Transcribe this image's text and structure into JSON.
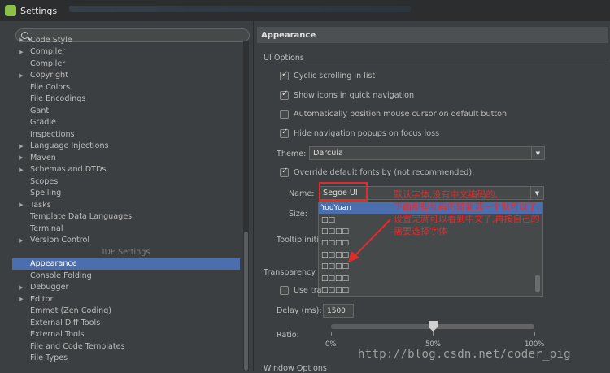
{
  "window": {
    "title": "Settings"
  },
  "search": {
    "placeholder": ""
  },
  "tree": {
    "items": [
      {
        "label": "Code Style",
        "arrow": "▶"
      },
      {
        "label": "Compiler",
        "arrow": "▶"
      },
      {
        "label": "Compiler",
        "arrow": ""
      },
      {
        "label": "Copyright",
        "arrow": "▶"
      },
      {
        "label": "File Colors",
        "arrow": ""
      },
      {
        "label": "File Encodings",
        "arrow": ""
      },
      {
        "label": "Gant",
        "arrow": ""
      },
      {
        "label": "Gradle",
        "arrow": ""
      },
      {
        "label": "Inspections",
        "arrow": ""
      },
      {
        "label": "Language Injections",
        "arrow": "▶"
      },
      {
        "label": "Maven",
        "arrow": "▶"
      },
      {
        "label": "Schemas and DTDs",
        "arrow": "▶"
      },
      {
        "label": "Scopes",
        "arrow": ""
      },
      {
        "label": "Spelling",
        "arrow": ""
      },
      {
        "label": "Tasks",
        "arrow": "▶"
      },
      {
        "label": "Template Data Languages",
        "arrow": ""
      },
      {
        "label": "Terminal",
        "arrow": ""
      },
      {
        "label": "Version Control",
        "arrow": "▶"
      }
    ],
    "group_label": "IDE Settings",
    "ide_items": [
      {
        "label": "Appearance",
        "arrow": ""
      },
      {
        "label": "Console Folding",
        "arrow": ""
      },
      {
        "label": "Debugger",
        "arrow": "▶"
      },
      {
        "label": "Editor",
        "arrow": "▶"
      },
      {
        "label": "Emmet (Zen Coding)",
        "arrow": ""
      },
      {
        "label": "External Diff Tools",
        "arrow": ""
      },
      {
        "label": "External Tools",
        "arrow": ""
      },
      {
        "label": "File and Code Templates",
        "arrow": ""
      },
      {
        "label": "File Types",
        "arrow": ""
      }
    ]
  },
  "panel": {
    "header": "Appearance",
    "ui_options_label": "UI Options",
    "checkboxes": [
      {
        "label": "Cyclic scrolling in list",
        "checked": true
      },
      {
        "label": "Show icons in quick navigation",
        "checked": true
      },
      {
        "label": "Automatically position mouse cursor on default button",
        "checked": false
      },
      {
        "label": "Hide navigation popups on focus loss",
        "checked": true
      }
    ],
    "theme_label": "Theme:",
    "theme_value": "Darcula",
    "override_label": "Override default fonts by (not recommended):",
    "override_checked": true,
    "name_label": "Name:",
    "name_value": "Segoe UI",
    "size_label": "Size:",
    "tooltip_label": "Tooltip initia",
    "font_options": [
      "YouYuan",
      "□□",
      "□□□□",
      "□□□□",
      "□□□□",
      "□□□□",
      "□□□□",
      "□□□□"
    ],
    "transparency_label": "Transparency",
    "use_transparency_label": "Use tra",
    "delay_label": "Delay (ms):",
    "delay_value": "1500",
    "ratio_label": "Ratio:",
    "ratio_value": 0.5,
    "ratio_ticks": [
      "0%",
      "50%",
      "100%"
    ],
    "window_options_label": "Window Options"
  },
  "annotation": {
    "line1": "默认字体,没有中文编码的,",
    "line2": "下面那些乱码的随便选一个就可以了,",
    "line3": "设置完就可以看到中文了,再按自己的",
    "line4": "需要选择字体"
  },
  "watermark": "http://blog.csdn.net/coder_pig",
  "colors": {
    "accent": "#4b6eaf",
    "annotation": "#e32b2b"
  }
}
